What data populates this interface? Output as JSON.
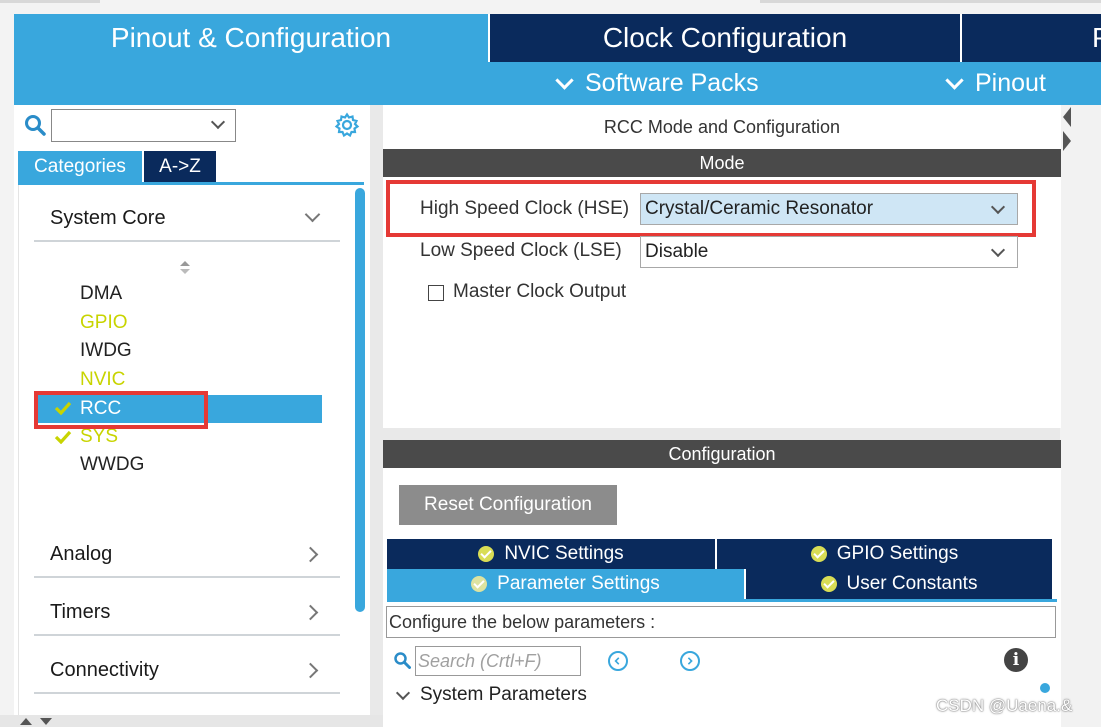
{
  "top_tabs": {
    "pinout_config": "Pinout & Configuration",
    "clock_config": "Clock Configuration",
    "project_manager_partial": "P"
  },
  "sub_menu": {
    "software_packs": "Software Packs",
    "pinout": "Pinout"
  },
  "left": {
    "search_value": "",
    "category_tabs": [
      "Categories",
      "A->Z"
    ],
    "groups": {
      "system_core": "System Core",
      "analog": "Analog",
      "timers": "Timers",
      "connectivity": "Connectivity"
    },
    "items": [
      {
        "label": "DMA",
        "status": "normal"
      },
      {
        "label": "GPIO",
        "status": "warning"
      },
      {
        "label": "IWDG",
        "status": "normal"
      },
      {
        "label": "NVIC",
        "status": "warning"
      },
      {
        "label": "RCC",
        "status": "selected-ok"
      },
      {
        "label": "SYS",
        "status": "ok"
      },
      {
        "label": "WWDG",
        "status": "normal"
      }
    ]
  },
  "mode_panel": {
    "title": "RCC Mode and Configuration",
    "section": "Mode",
    "hse_label": "High Speed Clock (HSE)",
    "hse_value": "Crystal/Ceramic Resonator",
    "lse_label": "Low Speed Clock (LSE)",
    "lse_value": "Disable",
    "master_clock_output": "Master Clock Output",
    "master_clock_output_checked": false
  },
  "config_panel": {
    "section": "Configuration",
    "reset_button": "Reset Configuration",
    "tabs": {
      "nvic": "NVIC Settings",
      "gpio": "GPIO Settings",
      "parameter": "Parameter Settings",
      "user_constants": "User Constants"
    },
    "description": "Configure the below parameters :",
    "search_placeholder": "Search (Crtl+F)",
    "system_parameters": "System Parameters"
  },
  "watermark": "CSDN @Uaena.&",
  "colors": {
    "accent_blue": "#39a7dd",
    "navy": "#0a2a5c",
    "highlight_red": "#e53935",
    "ok_yellow": "#c8d400"
  }
}
